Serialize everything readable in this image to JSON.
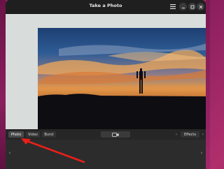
{
  "window": {
    "title": "Take a Photo"
  },
  "header": {
    "menu_icon": "hamburger-menu-icon",
    "minimize_icon": "minimize-icon",
    "maximize_icon": "maximize-icon",
    "close_icon": "close-icon"
  },
  "controls": {
    "modes": [
      "Photo",
      "Video",
      "Burst"
    ],
    "active_mode": "Photo",
    "shutter_icon": "camera-capture-icon",
    "effects_label": "Effects",
    "prev_icon": "chevron-left-icon",
    "next_icon": "chevron-right-icon"
  },
  "gallery": {
    "prev_icon": "chevron-left-icon",
    "next_icon": "chevron-right-icon"
  },
  "colors": {
    "accent_annotation": "#e8201a",
    "header_bg": "#1f1f1f",
    "desktop": "#b02f6d"
  }
}
